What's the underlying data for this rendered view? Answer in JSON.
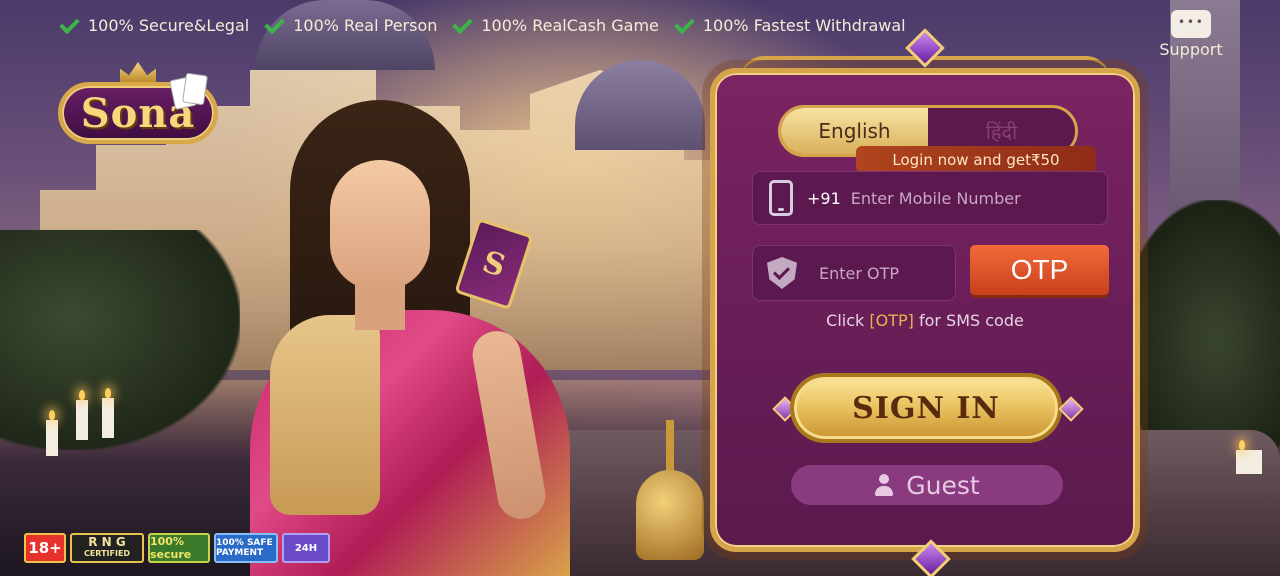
{
  "features": [
    "100% Secure&Legal",
    "100% Real Person",
    "100% RealCash Game",
    "100% Fastest Withdrawal"
  ],
  "support": {
    "label": "Support",
    "icon": "chat-bubble-icon"
  },
  "logo": {
    "text": "Sona"
  },
  "hero": {
    "card_letter": "S"
  },
  "login": {
    "languages": {
      "english": "English",
      "hindi": "हिंदी",
      "selected": "English"
    },
    "promo": "Login now and get₹50",
    "phone": {
      "country_code": "+91",
      "placeholder": "Enter Mobile Number",
      "value": ""
    },
    "otp": {
      "placeholder": "Enter OTP",
      "value": "",
      "button": "OTP"
    },
    "hint_prefix": "Click ",
    "hint_highlight": "[OTP]",
    "hint_suffix": " for SMS code",
    "signin": "SIGN IN",
    "guest": "Guest"
  },
  "badges": {
    "age": "18+",
    "rng_title": "R N G",
    "rng_sub": "CERTIFIED",
    "secure": "100% secure",
    "safe": "100% SAFE PAYMENT",
    "support24": "24H"
  },
  "colors": {
    "accent_gold": "#d6a54a",
    "panel_purple": "#6a1e58",
    "otp_orange": "#e2552a",
    "check_green": "#3bb54a"
  }
}
